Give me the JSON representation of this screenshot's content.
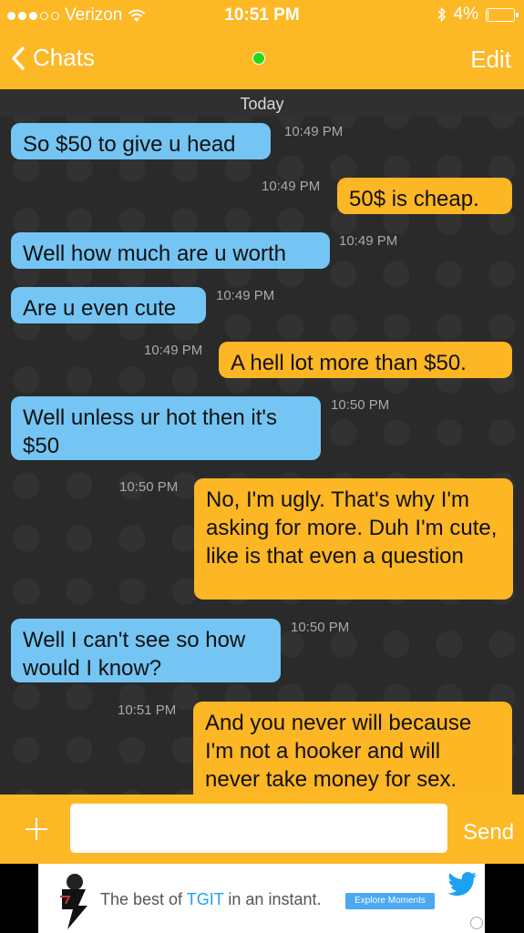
{
  "status": {
    "carrier": "Verizon",
    "time": "10:51 PM",
    "battery": "4%",
    "battery_level": 0.04
  },
  "nav": {
    "back_label": "Chats",
    "edit_label": "Edit"
  },
  "chat": {
    "date_label": "Today",
    "messages": [
      {
        "dir": "in",
        "text": "So $50 to give u head",
        "time": "10:49 PM"
      },
      {
        "dir": "out",
        "text": "50$ is cheap.",
        "time": "10:49 PM"
      },
      {
        "dir": "in",
        "text": "Well how much are u worth",
        "time": "10:49 PM"
      },
      {
        "dir": "in",
        "text": "Are u even cute",
        "time": "10:49 PM"
      },
      {
        "dir": "out",
        "text": "A hell lot more than $50.",
        "time": "10:49 PM"
      },
      {
        "dir": "in",
        "text": "Well unless ur hot then it's $50",
        "time": "10:50 PM"
      },
      {
        "dir": "out",
        "text": "No, I'm ugly. That's why I'm asking for more. Duh I'm cute, like is that even a question",
        "time": "10:50 PM"
      },
      {
        "dir": "in",
        "text": "Well I can't see so how would I know?",
        "time": "10:50 PM"
      },
      {
        "dir": "out",
        "text": "And you never will because I'm not a hooker and will never take money for sex.",
        "time": "10:51 PM"
      }
    ]
  },
  "composer": {
    "value": "",
    "send_label": "Send"
  },
  "ad": {
    "text_before": "The best of ",
    "brand": "TGIT",
    "text_after": " in an instant.",
    "cta": "Explore Moments"
  },
  "colors": {
    "accent": "#fdb826",
    "incoming": "#74c5f3",
    "outgoing": "#fdb624",
    "online": "#22d81c"
  }
}
